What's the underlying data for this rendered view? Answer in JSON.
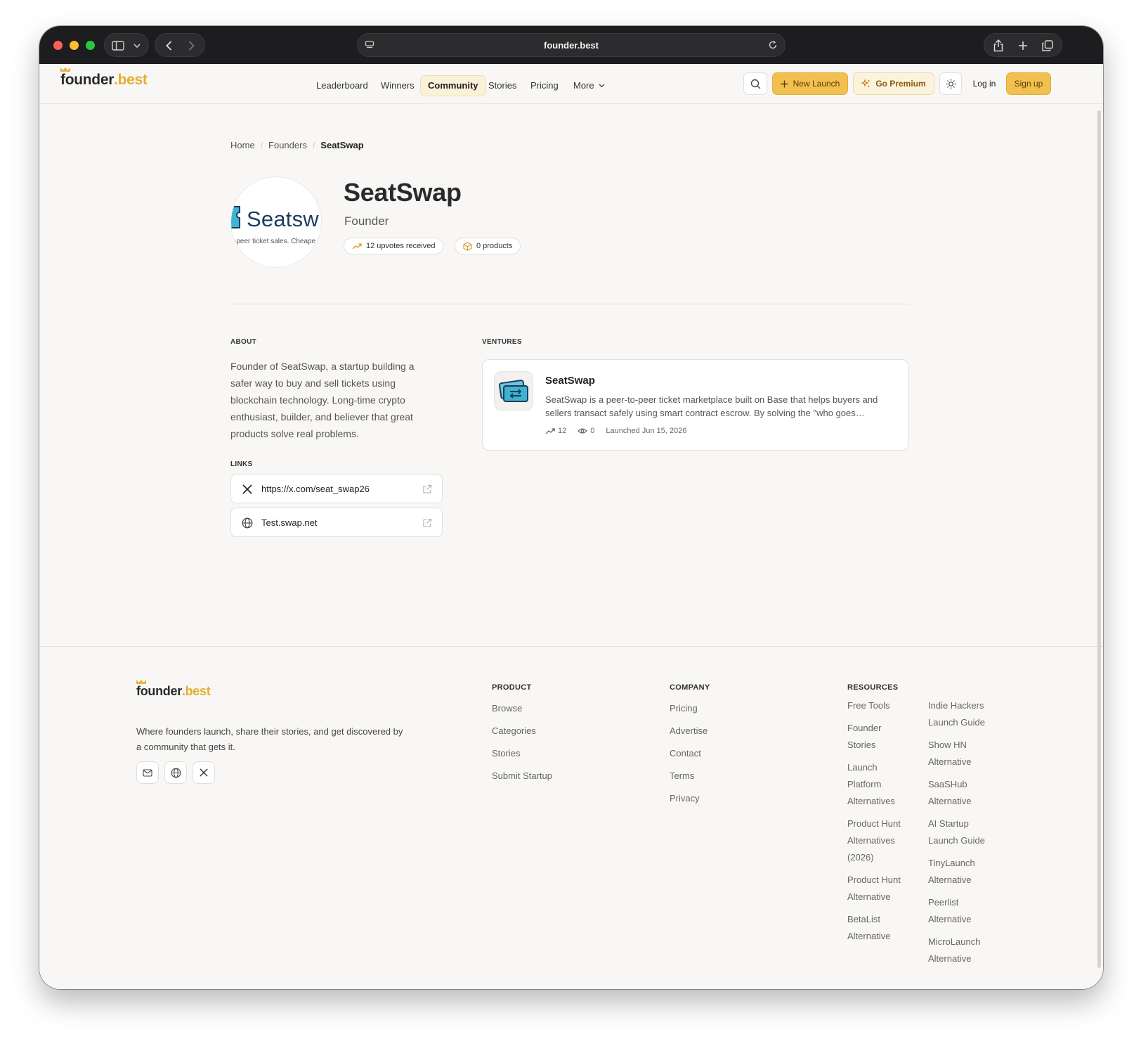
{
  "browser": {
    "url": "founder.best"
  },
  "brand": {
    "name_main": "ounder",
    "name_dot": ".best",
    "accent": "#e6ad2e"
  },
  "nav": {
    "items": [
      "Leaderboard",
      "Winners",
      "Community",
      "Stories",
      "Pricing",
      "More"
    ],
    "active": "Community"
  },
  "header_actions": {
    "new_launch": "New Launch",
    "go_premium": "Go Premium",
    "login": "Log in",
    "signup": "Sign up"
  },
  "breadcrumb": [
    "Home",
    "Founders",
    "SeatSwap"
  ],
  "profile": {
    "avatar_text": "Seatsw",
    "avatar_sub": "-peer ticket sales. Cheape",
    "name": "SeatSwap",
    "role": "Founder",
    "upvotes": "12 upvotes received",
    "products": "0 products"
  },
  "about": {
    "label": "ABOUT",
    "text": "Founder of SeatSwap, a startup building a safer way to buy and sell tickets using blockchain technology. Long-time crypto enthusiast, builder, and believer that great products solve real problems."
  },
  "links": {
    "label": "LINKS",
    "items": [
      {
        "icon": "x-logo-icon",
        "text": "https://x.com/seat_swap26"
      },
      {
        "icon": "globe-icon",
        "text": "Test.swap.net"
      }
    ]
  },
  "ventures": {
    "label": "VENTURES",
    "items": [
      {
        "name": "SeatSwap",
        "description": "SeatSwap is a peer-to-peer ticket marketplace built on Base that helps buyers and sellers transact safely using smart contract escrow. By solving the \"who goes…",
        "upvotes": "12",
        "views": "0",
        "launched": "Launched Jun 15, 2026"
      }
    ]
  },
  "footer": {
    "tagline": "Where founders launch, share their stories, and get discovered by a community that gets it.",
    "product": {
      "heading": "PRODUCT",
      "links": [
        "Browse",
        "Categories",
        "Stories",
        "Submit Startup"
      ]
    },
    "company": {
      "heading": "COMPANY",
      "links": [
        "Pricing",
        "Advertise",
        "Contact",
        "Terms",
        "Privacy"
      ]
    },
    "resources": {
      "heading": "RESOURCES",
      "col1": [
        "Free Tools",
        "Founder Stories",
        "Launch Platform Alternatives",
        "Product Hunt Alternatives (2026)",
        "Product Hunt Alternative",
        "BetaList Alternative"
      ],
      "col2": [
        "Indie Hackers Launch Guide",
        "Show HN Alternative",
        "SaaSHub Alternative",
        "AI Startup Launch Guide",
        "TinyLaunch Alternative",
        "Peerlist Alternative",
        "MicroLaunch Alternative"
      ]
    }
  }
}
